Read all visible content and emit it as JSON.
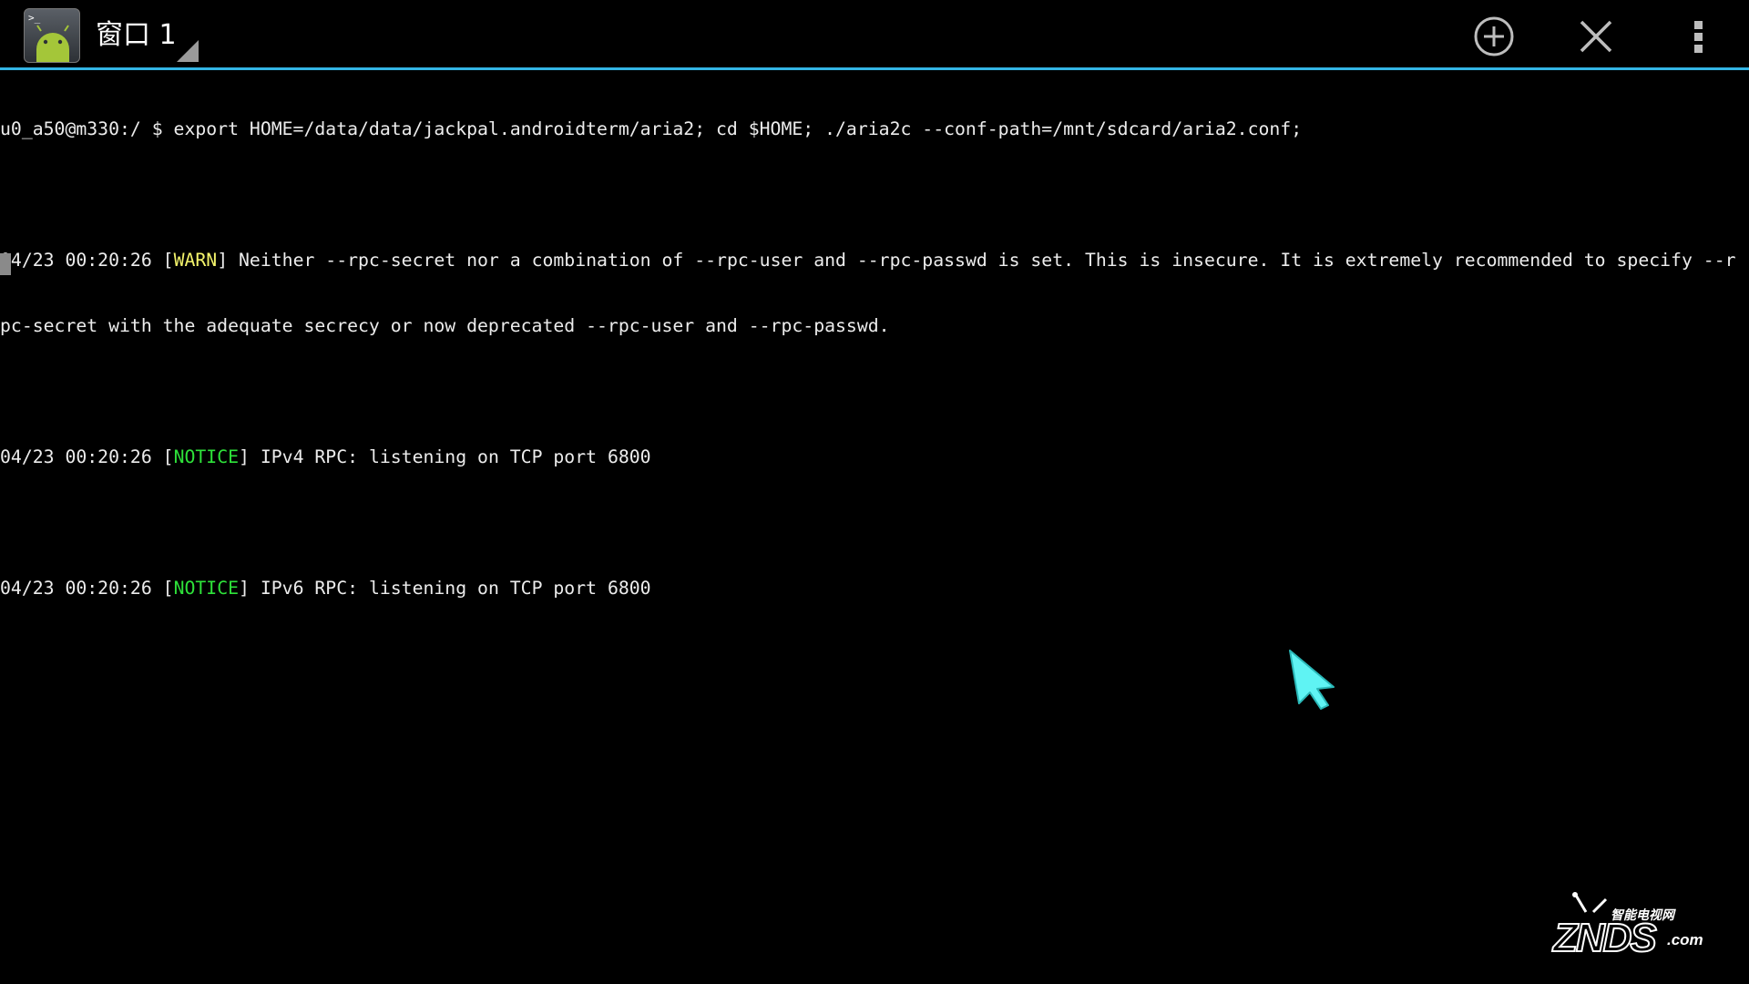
{
  "action_bar": {
    "window_title": "窗口 1",
    "app_icon": "android-terminal-icon",
    "prompt_glyph": ">_",
    "accent_color": "#33b5e5",
    "buttons": {
      "new_window_icon": "add-circle-icon",
      "close_window_icon": "close-icon",
      "overflow_icon": "overflow-menu-icon"
    }
  },
  "terminal": {
    "lines": [
      {
        "text": "u0_a50@m330:/ $ export HOME=/data/data/jackpal.androidterm/aria2; cd $HOME; ./aria2c --conf-path=/mnt/sdcard/aria2.conf;"
      },
      {
        "text": ""
      },
      {
        "prefix": "04/23 00:20:26 [",
        "tag": "WARN",
        "tag_type": "warn",
        "suffix": "] Neither --rpc-secret nor a combination of --rpc-user and --rpc-passwd is set. This is insecure. It is extremely recommended to specify --r"
      },
      {
        "text": "pc-secret with the adequate secrecy or now deprecated --rpc-user and --rpc-passwd."
      },
      {
        "text": ""
      },
      {
        "prefix": "04/23 00:20:26 [",
        "tag": "NOTICE",
        "tag_type": "notice",
        "suffix": "] IPv4 RPC: listening on TCP port 6800"
      },
      {
        "text": ""
      },
      {
        "prefix": "04/23 00:20:26 [",
        "tag": "NOTICE",
        "tag_type": "notice",
        "suffix": "] IPv6 RPC: listening on TCP port 6800"
      }
    ],
    "colors": {
      "text": "#ececec",
      "warn": "#f3f36b",
      "notice": "#2ee23a",
      "background": "#000000"
    }
  },
  "pointer": {
    "icon": "mouse-pointer-icon",
    "color": "#5ff3f3"
  },
  "watermark": {
    "top_text": "智能电视网",
    "brand": "ZNDS",
    "suffix": ".com"
  }
}
